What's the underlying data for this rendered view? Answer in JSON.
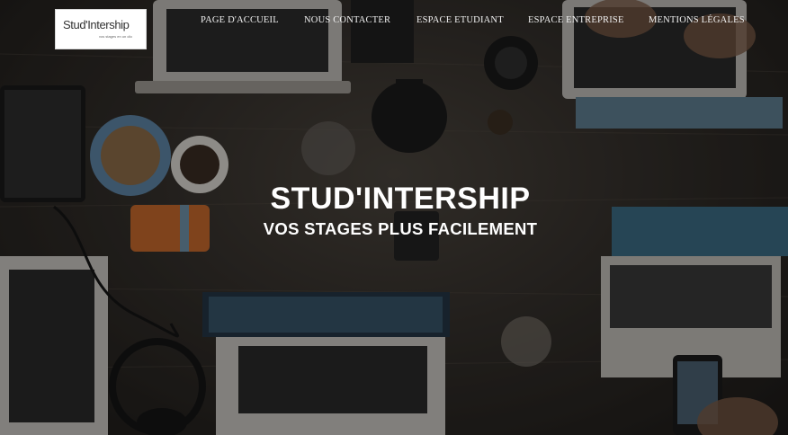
{
  "logo": {
    "brand": "Stud'Intership",
    "tagline": "vos stages en un clic"
  },
  "nav": {
    "items": [
      {
        "label": "PAGE D'ACCUEIL"
      },
      {
        "label": "NOUS CONTACTER"
      },
      {
        "label": "ESPACE ETUDIANT"
      },
      {
        "label": "ESPACE ENTREPRISE"
      },
      {
        "label": "MENTIONS LÉGALES"
      }
    ]
  },
  "hero": {
    "title": "STUD'INTERSHIP",
    "subtitle": "VOS STAGES PLUS FACILEMENT"
  }
}
